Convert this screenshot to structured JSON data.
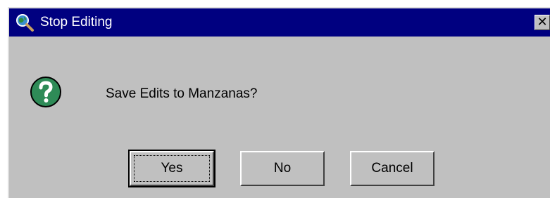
{
  "window": {
    "title": "Stop Editing",
    "close_glyph": "✕",
    "app_icon": "globe-magnifier-icon",
    "titlebar_color": "#000080",
    "face_color": "#c0c0c0"
  },
  "dialog": {
    "icon": "question-icon",
    "icon_color": "#2e8b57",
    "message": "Save Edits to Manzanas?"
  },
  "buttons": {
    "yes": "Yes",
    "no": "No",
    "cancel": "Cancel"
  }
}
